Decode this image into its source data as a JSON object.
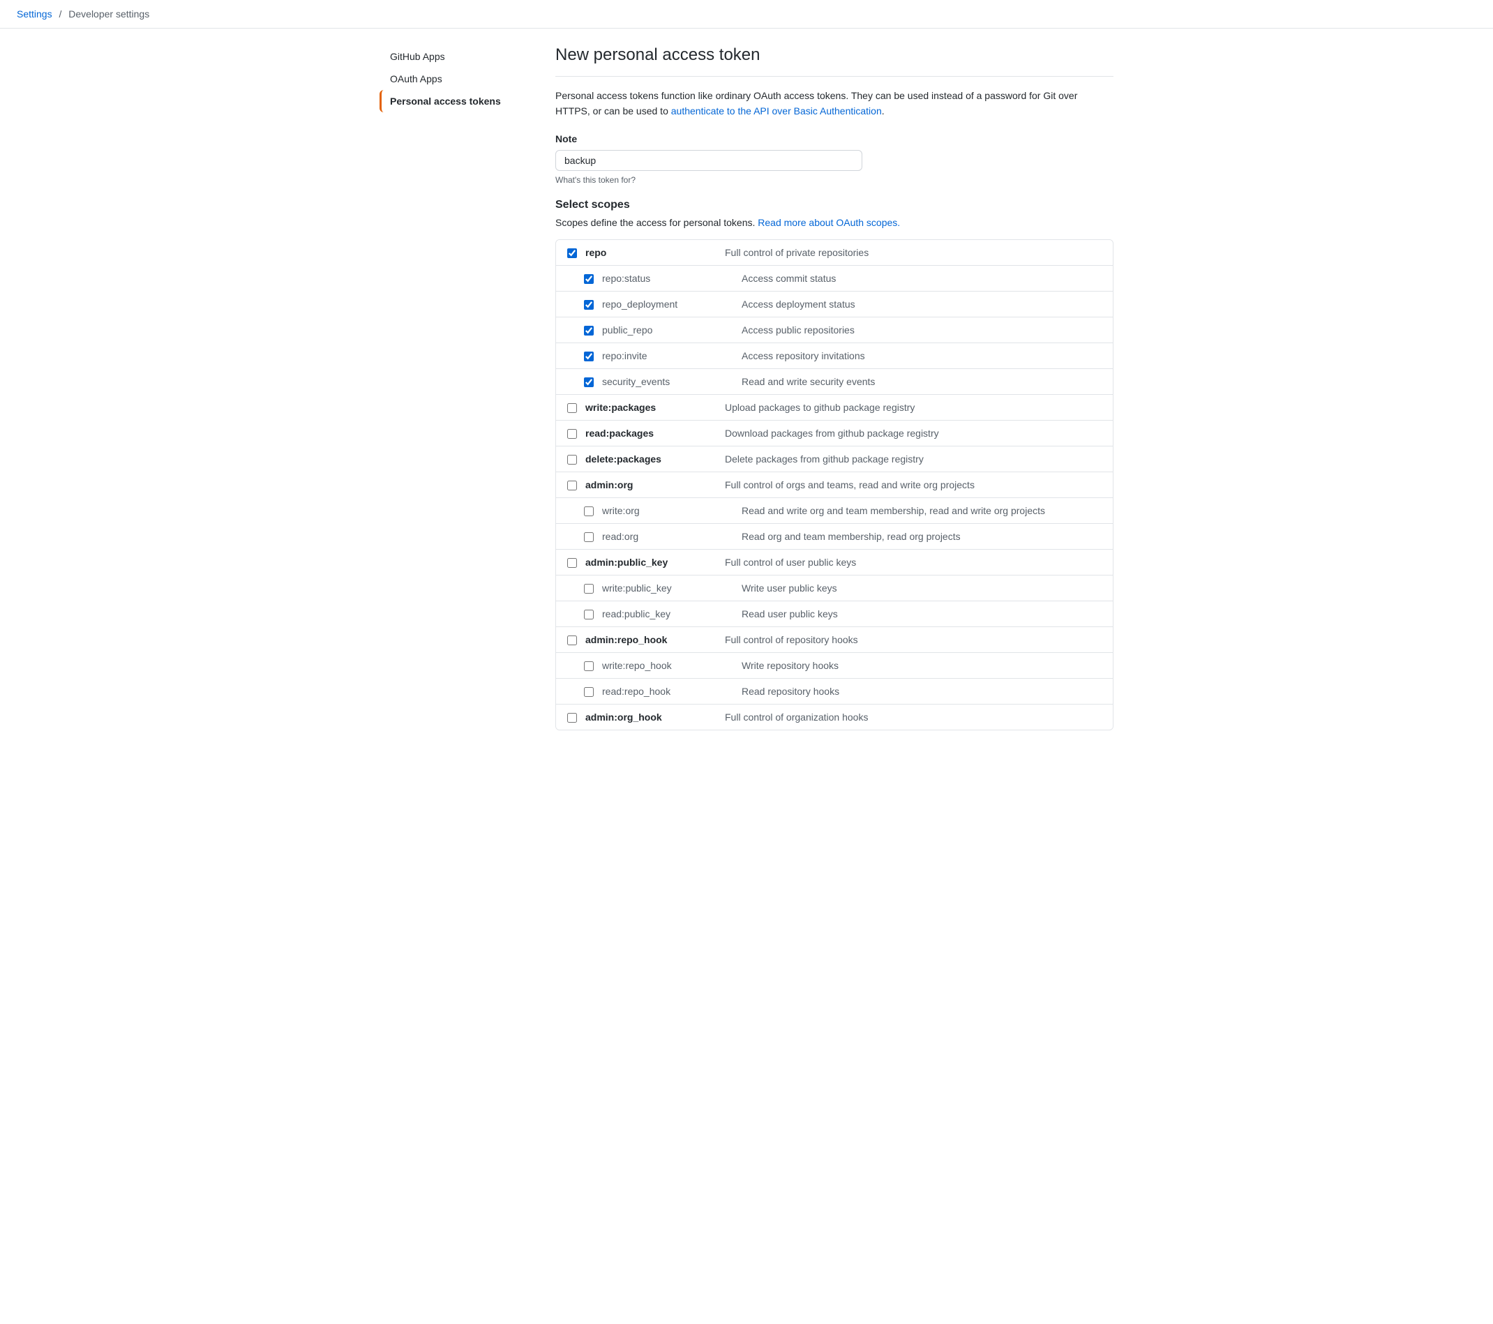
{
  "breadcrumb": {
    "settings_label": "Settings",
    "separator": "/",
    "developer_settings_label": "Developer settings"
  },
  "sidebar": {
    "items": [
      {
        "id": "github-apps",
        "label": "GitHub Apps",
        "active": false
      },
      {
        "id": "oauth-apps",
        "label": "OAuth Apps",
        "active": false
      },
      {
        "id": "personal-access-tokens",
        "label": "Personal access tokens",
        "active": true
      }
    ]
  },
  "main": {
    "page_title": "New personal access token",
    "description_text": "Personal access tokens function like ordinary OAuth access tokens. They can be used instead of a password for Git over HTTPS, or can be used to ",
    "description_link_text": "authenticate to the API over Basic Authentication",
    "description_end": ".",
    "note_label": "Note",
    "note_placeholder": "backup",
    "note_hint": "What's this token for?",
    "scopes_title": "Select scopes",
    "scopes_desc_text": "Scopes define the access for personal tokens. ",
    "scopes_link_text": "Read more about OAuth scopes.",
    "scopes": [
      {
        "id": "repo",
        "name": "repo",
        "description": "Full control of private repositories",
        "checked": true,
        "parent": false,
        "sub": false,
        "children": [
          {
            "id": "repo_status",
            "name": "repo:status",
            "description": "Access commit status",
            "checked": true
          },
          {
            "id": "repo_deployment",
            "name": "repo_deployment",
            "description": "Access deployment status",
            "checked": true
          },
          {
            "id": "public_repo",
            "name": "public_repo",
            "description": "Access public repositories",
            "checked": true
          },
          {
            "id": "repo_invite",
            "name": "repo:invite",
            "description": "Access repository invitations",
            "checked": true
          },
          {
            "id": "security_events",
            "name": "security_events",
            "description": "Read and write security events",
            "checked": true
          }
        ]
      },
      {
        "id": "write_packages",
        "name": "write:packages",
        "description": "Upload packages to github package registry",
        "checked": false,
        "children": []
      },
      {
        "id": "read_packages",
        "name": "read:packages",
        "description": "Download packages from github package registry",
        "checked": false,
        "children": []
      },
      {
        "id": "delete_packages",
        "name": "delete:packages",
        "description": "Delete packages from github package registry",
        "checked": false,
        "children": []
      },
      {
        "id": "admin_org",
        "name": "admin:org",
        "description": "Full control of orgs and teams, read and write org projects",
        "checked": false,
        "children": [
          {
            "id": "write_org",
            "name": "write:org",
            "description": "Read and write org and team membership, read and write org projects",
            "checked": false
          },
          {
            "id": "read_org",
            "name": "read:org",
            "description": "Read org and team membership, read org projects",
            "checked": false
          }
        ]
      },
      {
        "id": "admin_public_key",
        "name": "admin:public_key",
        "description": "Full control of user public keys",
        "checked": false,
        "children": [
          {
            "id": "write_public_key",
            "name": "write:public_key",
            "description": "Write user public keys",
            "checked": false
          },
          {
            "id": "read_public_key",
            "name": "read:public_key",
            "description": "Read user public keys",
            "checked": false
          }
        ]
      },
      {
        "id": "admin_repo_hook",
        "name": "admin:repo_hook",
        "description": "Full control of repository hooks",
        "checked": false,
        "children": [
          {
            "id": "write_repo_hook",
            "name": "write:repo_hook",
            "description": "Write repository hooks",
            "checked": false
          },
          {
            "id": "read_repo_hook",
            "name": "read:repo_hook",
            "description": "Read repository hooks",
            "checked": false
          }
        ]
      },
      {
        "id": "admin_org_hook",
        "name": "admin:org_hook",
        "description": "Full control of organization hooks",
        "checked": false,
        "children": []
      }
    ]
  }
}
